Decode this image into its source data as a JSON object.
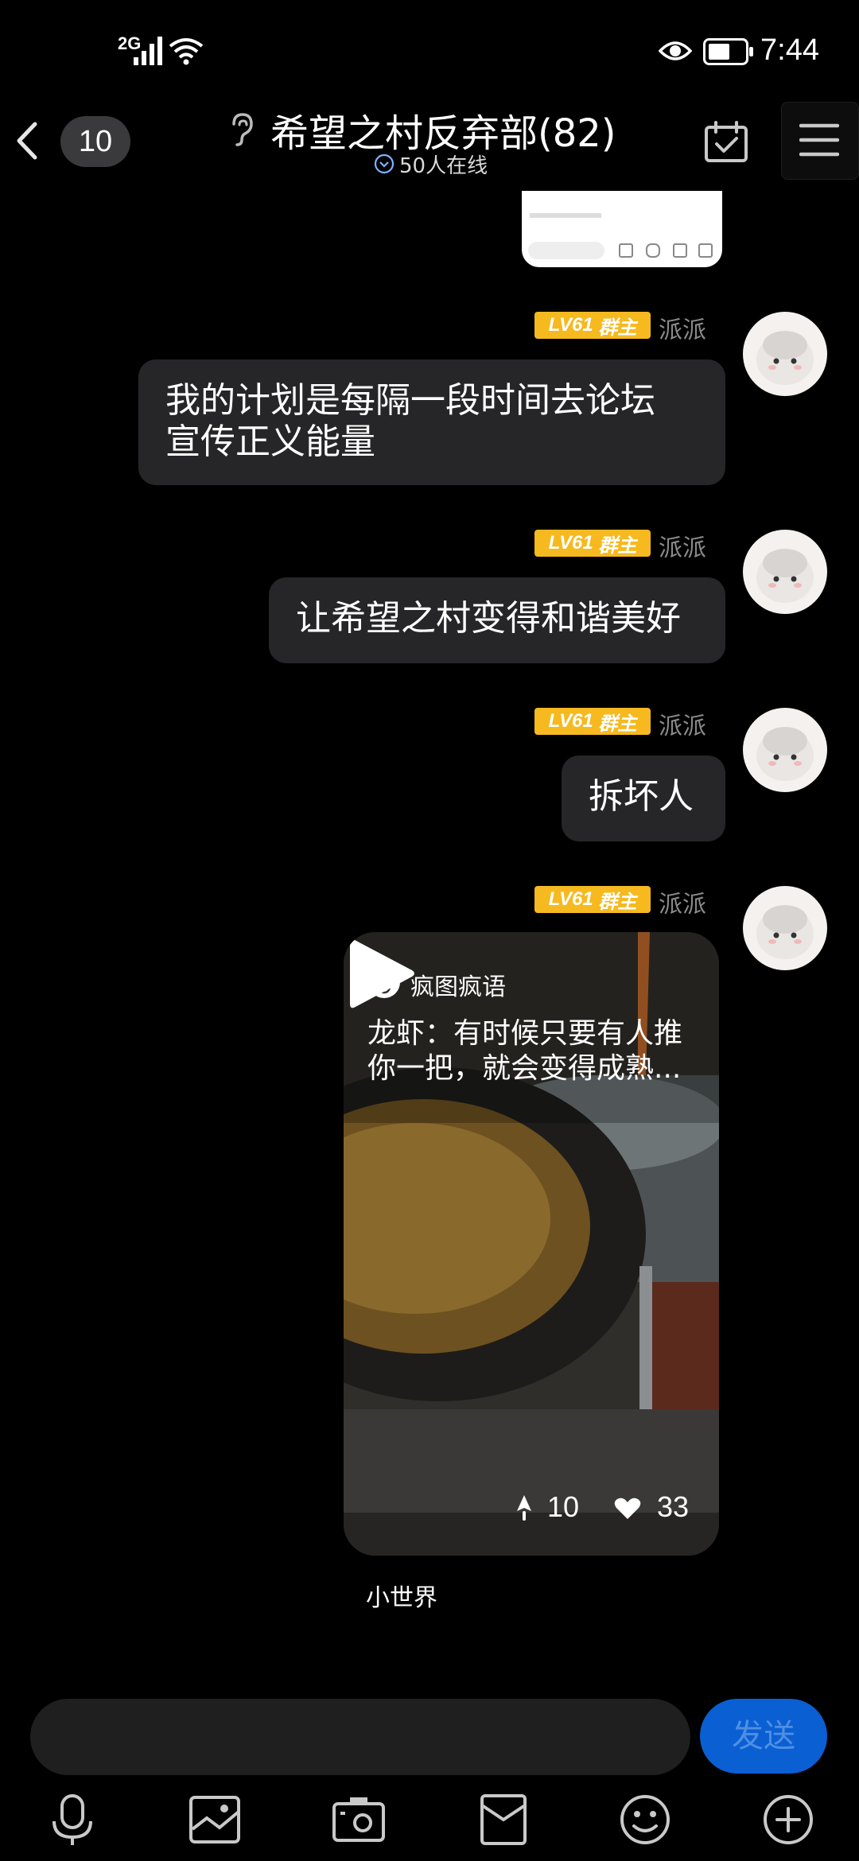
{
  "status_bar": {
    "network": "2G",
    "time": "7:44"
  },
  "header": {
    "unread_count": "10",
    "title": "希望之村反弃部(82)",
    "online_text": "50人在线"
  },
  "messages": [
    {
      "level": "LV61",
      "role": "群主",
      "nickname": "派派",
      "text_lines": [
        "我的计划是每隔一段时间去论坛",
        "宣传正义能量"
      ]
    },
    {
      "level": "LV61",
      "role": "群主",
      "nickname": "派派",
      "text": "让希望之村变得和谐美好"
    },
    {
      "level": "LV61",
      "role": "群主",
      "nickname": "派派",
      "text": "拆坏人"
    },
    {
      "level": "LV61",
      "role": "群主",
      "nickname": "派派",
      "video": {
        "author": "疯图疯语",
        "caption": "龙虾：有时候只要有人推你一把，就会变得成熟...",
        "caption_line1": "龙虾：有时候只要有人推",
        "caption_line2": "你一把，就会变得成熟...",
        "shares": "10",
        "likes": "33",
        "source": "小世界"
      }
    }
  ],
  "input_bar": {
    "send_label": "发送"
  },
  "toolbar": [
    "microphone-icon",
    "image-icon",
    "camera-icon",
    "red-packet-icon",
    "emoji-icon",
    "plus-icon"
  ],
  "colors": {
    "background": "#000000",
    "bubble": "#262628",
    "level_badge": "#f6b91f",
    "send_button": "#0a5fd3"
  }
}
